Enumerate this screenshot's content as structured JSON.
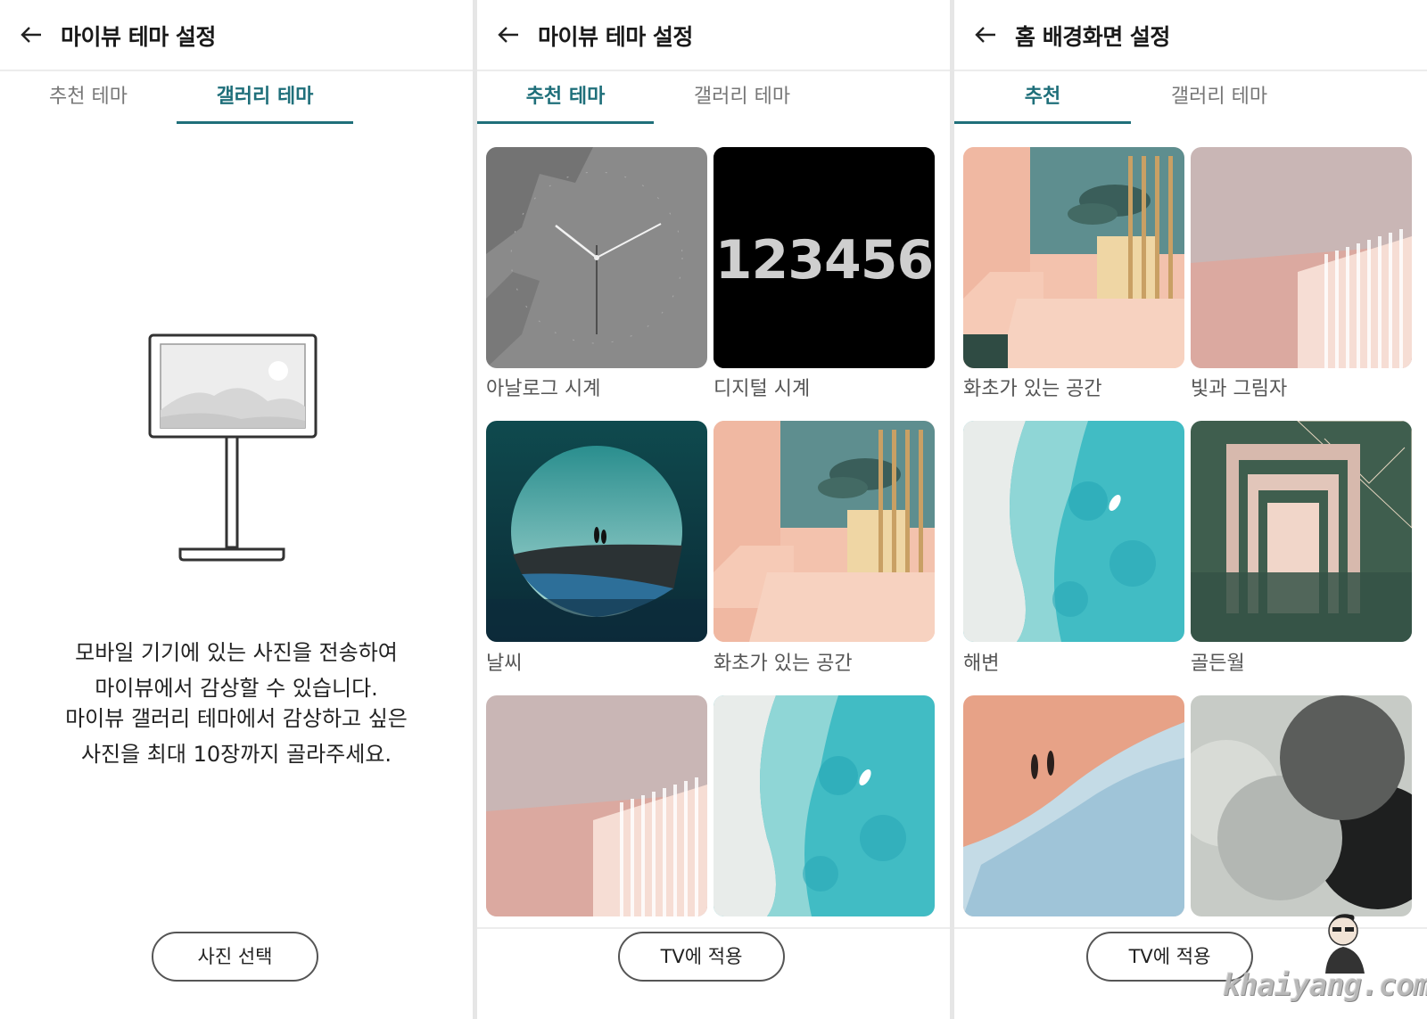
{
  "screens": [
    {
      "title": "마이뷰 테마 설정",
      "tabs": [
        {
          "label": "추천 테마",
          "active": false
        },
        {
          "label": "갤러리 테마",
          "active": true
        }
      ],
      "description": [
        "모바일 기기에 있는 사진을 전송하여",
        "마이뷰에서 감상할 수 있습니다.",
        "마이뷰 갤러리 테마에서 감상하고 싶은",
        "사진을 최대 10장까지 골라주세요."
      ],
      "button": "사진 선택"
    },
    {
      "title": "마이뷰 테마 설정",
      "tabs": [
        {
          "label": "추천 테마",
          "active": true
        },
        {
          "label": "갤러리 테마",
          "active": false
        }
      ],
      "items": [
        "아날로그 시계",
        "디지털 시계",
        "날씨",
        "화초가 있는 공간",
        "",
        ""
      ],
      "digital_clock_digits": "123456",
      "button": "TV에 적용"
    },
    {
      "title": "홈 배경화면 설정",
      "tabs": [
        {
          "label": "추천",
          "active": true
        },
        {
          "label": "갤러리 테마",
          "active": false
        }
      ],
      "items": [
        "화초가 있는 공간",
        "빛과 그림자",
        "해변",
        "골든월",
        "",
        ""
      ],
      "button": "TV에 적용"
    }
  ],
  "watermark": "khaiyang.com",
  "colors": {
    "accent": "#1f6f7a",
    "tab_inactive": "#777777"
  }
}
